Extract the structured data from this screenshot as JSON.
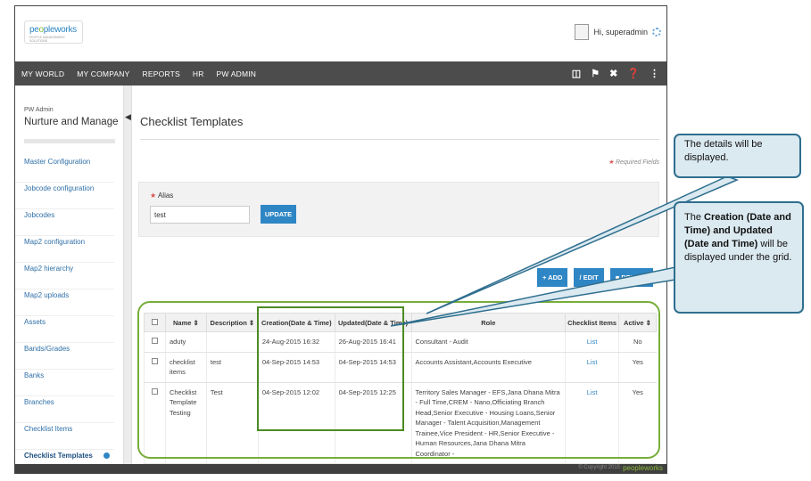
{
  "header": {
    "logo_text_1": "pe",
    "logo_text_o": "o",
    "logo_text_2": "pleworks",
    "logo_tagline": "PEOPLE MANAGEMENT SOLUTIONS",
    "greeting": "Hi, superadmin"
  },
  "nav": {
    "items": [
      "MY WORLD",
      "MY COMPANY",
      "REPORTS",
      "HR",
      "PW ADMIN"
    ],
    "icons": [
      "book-icon",
      "flag-icon",
      "tools-icon",
      "help-icon",
      "share-icon"
    ]
  },
  "sidebar": {
    "section_small": "PW Admin",
    "section_title": "Nurture and Manage",
    "items": [
      "Master Configuration",
      "Jobcode configuration",
      "Jobcodes",
      "Map2 configuration",
      "Map2 hierarchy",
      "Map2 uploads",
      "Assets",
      "Bands/Grades",
      "Banks",
      "Branches",
      "Checklist Items",
      "Checklist Templates"
    ]
  },
  "main": {
    "title": "Checklist Templates",
    "required_label": "Required Fields",
    "alias_label": "Alias",
    "alias_value": "test",
    "update_label": "UPDATE",
    "add_label": "+ ADD",
    "edit_label": "/ EDIT",
    "delete_label": "DELETE"
  },
  "grid": {
    "columns": [
      "Name",
      "Description",
      "Creation(Date & Time)",
      "Updated(Date & Time)",
      "Role",
      "Checklist Items",
      "Active"
    ],
    "rows": [
      {
        "name": "aduty",
        "description": "",
        "created": "24-Aug-2015 16:32",
        "updated": "26-Aug-2015 16:41",
        "role": "Consultant - Audit",
        "items": "List",
        "active": "No"
      },
      {
        "name": "checklist items",
        "description": "test",
        "created": "04-Sep-2015 14:53",
        "updated": "04-Sep-2015 14:53",
        "role": "Accounts Assistant,Accounts Executive",
        "items": "List",
        "active": "Yes"
      },
      {
        "name": "Checklist Template Testing",
        "description": "Test",
        "created": "04-Sep-2015 12:02",
        "updated": "04-Sep-2015 12:25",
        "role": "Territory Sales Manager - EFS,Jana Dhana Mitra - Full Time,CREM - Nano,Officiating Branch Head,Senior Executive - Housing Loans,Senior Manager - Talent Acquisition,Management Trainee,Vice President - HR,Senior Executive - Human Resources,Jana Dhana Mitra Coordinator -",
        "items": "List",
        "active": "Yes"
      }
    ]
  },
  "footer": {
    "copyright": "© Copyright 2015",
    "logo": "peopleworks"
  },
  "callouts": {
    "first": "The details will be displayed.",
    "second_pre": "The ",
    "second_bold_1": "Creation (Date and Time)",
    "second_mid": " and ",
    "second_bold_2": "Updated (Date and Time)",
    "second_post": " will be displayed under the grid."
  },
  "colors": {
    "accent": "#2f86c4",
    "nav_bg": "#4c4c4c",
    "highlight_green": "#78ad3a",
    "callout_bg": "#dbe9f0",
    "callout_border": "#2e6e8e"
  }
}
